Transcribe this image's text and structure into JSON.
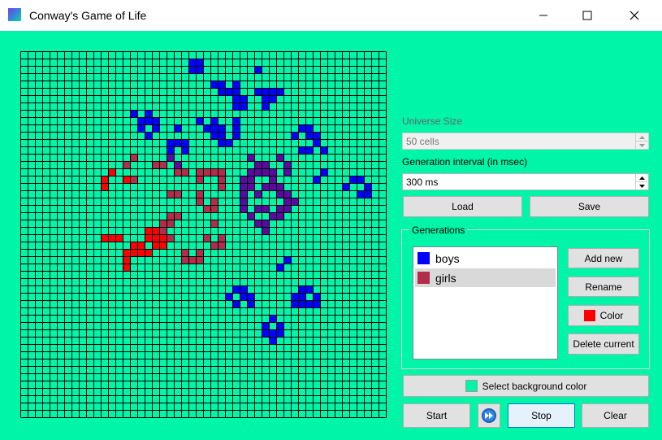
{
  "window": {
    "title": "Conway's Game of Life",
    "minimize_icon": "minimize-icon",
    "maximize_icon": "maximize-icon",
    "close_icon": "close-icon"
  },
  "colors": {
    "background": "#00f5a8",
    "grid_line": "#000000",
    "boys": "#0000ff",
    "girls": "#b22d4a",
    "mixed": "#5a0aa0",
    "red": "#ff0000"
  },
  "universe": {
    "size": 50,
    "blue_cells": [
      [
        24,
        1
      ],
      [
        23,
        1
      ],
      [
        24,
        2
      ],
      [
        23,
        2
      ],
      [
        32,
        2
      ],
      [
        27,
        4
      ],
      [
        26,
        4
      ],
      [
        29,
        4
      ],
      [
        27,
        5
      ],
      [
        29,
        5
      ],
      [
        28,
        5
      ],
      [
        33,
        5
      ],
      [
        34,
        5
      ],
      [
        32,
        5
      ],
      [
        35,
        5
      ],
      [
        30,
        6
      ],
      [
        33,
        6
      ],
      [
        29,
        6
      ],
      [
        34,
        6
      ],
      [
        33,
        7
      ],
      [
        30,
        7
      ],
      [
        29,
        7
      ],
      [
        17,
        8
      ],
      [
        15,
        8
      ],
      [
        18,
        9
      ],
      [
        24,
        9
      ],
      [
        17,
        9
      ],
      [
        16,
        9
      ],
      [
        26,
        9
      ],
      [
        29,
        9
      ],
      [
        18,
        10
      ],
      [
        29,
        10
      ],
      [
        16,
        10
      ],
      [
        27,
        10
      ],
      [
        26,
        10
      ],
      [
        21,
        10
      ],
      [
        38,
        10
      ],
      [
        25,
        10
      ],
      [
        39,
        10
      ],
      [
        17,
        11
      ],
      [
        39,
        11
      ],
      [
        37,
        11
      ],
      [
        29,
        11
      ],
      [
        27,
        11
      ],
      [
        26,
        11
      ],
      [
        40,
        11
      ],
      [
        21,
        12
      ],
      [
        28,
        12
      ],
      [
        22,
        12
      ],
      [
        20,
        12
      ],
      [
        40,
        12
      ],
      [
        27,
        12
      ],
      [
        41,
        13
      ],
      [
        20,
        13
      ],
      [
        38,
        13
      ],
      [
        22,
        13
      ],
      [
        39,
        13
      ],
      [
        41,
        16
      ],
      [
        40,
        17
      ],
      [
        46,
        17
      ],
      [
        45,
        17
      ],
      [
        44,
        18
      ],
      [
        47,
        18
      ],
      [
        46,
        19
      ],
      [
        47,
        19
      ],
      [
        36,
        28
      ],
      [
        35,
        29
      ],
      [
        29,
        32
      ],
      [
        30,
        32
      ],
      [
        38,
        32
      ],
      [
        39,
        32
      ],
      [
        30,
        33
      ],
      [
        38,
        33
      ],
      [
        31,
        33
      ],
      [
        28,
        33
      ],
      [
        40,
        33
      ],
      [
        37,
        33
      ],
      [
        40,
        34
      ],
      [
        29,
        34
      ],
      [
        39,
        34
      ],
      [
        37,
        34
      ],
      [
        38,
        34
      ],
      [
        31,
        34
      ],
      [
        34,
        36
      ],
      [
        35,
        37
      ],
      [
        33,
        37
      ],
      [
        33,
        38
      ],
      [
        34,
        38
      ],
      [
        35,
        38
      ],
      [
        34,
        39
      ]
    ],
    "purple_cells": [
      [
        20,
        14
      ],
      [
        35,
        14
      ],
      [
        31,
        14
      ],
      [
        21,
        15
      ],
      [
        33,
        15
      ],
      [
        36,
        15
      ],
      [
        32,
        15
      ],
      [
        36,
        16
      ],
      [
        33,
        16
      ],
      [
        32,
        16
      ],
      [
        31,
        16
      ],
      [
        34,
        16
      ],
      [
        30,
        17
      ],
      [
        31,
        17
      ],
      [
        34,
        17
      ],
      [
        33,
        18
      ],
      [
        30,
        18
      ],
      [
        31,
        18
      ],
      [
        35,
        18
      ],
      [
        34,
        18
      ],
      [
        30,
        19
      ],
      [
        32,
        19
      ],
      [
        36,
        19
      ],
      [
        35,
        19
      ],
      [
        36,
        20
      ],
      [
        30,
        20
      ],
      [
        37,
        20
      ],
      [
        30,
        21
      ],
      [
        35,
        21
      ],
      [
        32,
        21
      ],
      [
        36,
        21
      ],
      [
        33,
        21
      ],
      [
        31,
        22
      ],
      [
        34,
        22
      ],
      [
        35,
        22
      ],
      [
        33,
        23
      ],
      [
        32,
        23
      ],
      [
        33,
        24
      ]
    ],
    "girls_cells": [
      [
        15,
        14
      ],
      [
        14,
        15
      ],
      [
        18,
        15
      ],
      [
        19,
        15
      ],
      [
        21,
        16
      ],
      [
        24,
        16
      ],
      [
        26,
        16
      ],
      [
        27,
        16
      ],
      [
        25,
        16
      ],
      [
        22,
        16
      ],
      [
        15,
        17
      ],
      [
        27,
        17
      ],
      [
        24,
        17
      ],
      [
        27,
        18
      ],
      [
        21,
        19
      ],
      [
        20,
        19
      ],
      [
        24,
        19
      ],
      [
        24,
        20
      ],
      [
        26,
        20
      ],
      [
        26,
        21
      ],
      [
        25,
        21
      ],
      [
        20,
        22
      ],
      [
        21,
        22
      ],
      [
        26,
        23
      ],
      [
        20,
        23
      ],
      [
        19,
        23
      ],
      [
        19,
        24
      ],
      [
        27,
        25
      ],
      [
        20,
        25
      ],
      [
        25,
        25
      ],
      [
        27,
        26
      ],
      [
        26,
        26
      ],
      [
        22,
        27
      ],
      [
        24,
        27
      ],
      [
        22,
        28
      ],
      [
        23,
        28
      ],
      [
        24,
        28
      ]
    ],
    "red_cells": [
      [
        12,
        16
      ],
      [
        11,
        17
      ],
      [
        14,
        17
      ],
      [
        11,
        18
      ],
      [
        17,
        24
      ],
      [
        18,
        24
      ],
      [
        18,
        25
      ],
      [
        11,
        25
      ],
      [
        19,
        25
      ],
      [
        12,
        25
      ],
      [
        13,
        25
      ],
      [
        17,
        25
      ],
      [
        16,
        26
      ],
      [
        19,
        26
      ],
      [
        18,
        26
      ],
      [
        18,
        26
      ],
      [
        15,
        26
      ],
      [
        14,
        27
      ],
      [
        15,
        27
      ],
      [
        16,
        27
      ],
      [
        17,
        27
      ],
      [
        14,
        28
      ],
      [
        14,
        29
      ]
    ]
  },
  "controls": {
    "universe_size_label": "Universe Size",
    "universe_size_value": "50 cells",
    "interval_label": "Generation interval (in msec)",
    "interval_value": "300 ms",
    "load_label": "Load",
    "save_label": "Save"
  },
  "generations": {
    "title": "Generations",
    "items": [
      {
        "label": "boys",
        "color": "#0000ff"
      },
      {
        "label": "girls",
        "color": "#b22d4a"
      }
    ],
    "add_new_label": "Add new",
    "rename_label": "Rename",
    "color_label": "Color",
    "delete_label": "Delete current"
  },
  "bottom": {
    "bg_color_label": "Select background color",
    "start_label": "Start",
    "fast_forward_icon": "fast-forward-icon",
    "stop_label": "Stop",
    "clear_label": "Clear"
  }
}
